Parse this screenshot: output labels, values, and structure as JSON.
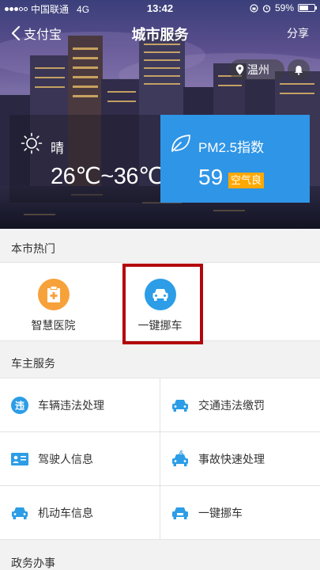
{
  "status_bar": {
    "carrier": "中国联通",
    "network": "4G",
    "time": "13:42",
    "battery_percent": "59%",
    "battery_level": 0.59
  },
  "navbar": {
    "back_label": "支付宝",
    "title": "城市服务",
    "share_label": "分享"
  },
  "location": {
    "city": "温州"
  },
  "weather": {
    "condition": "晴",
    "temperature": "26℃~36℃",
    "icon": "sun-icon"
  },
  "air_quality": {
    "label": "PM2.5指数",
    "value": "59",
    "level": "空气良",
    "card_color": "#2f95e6",
    "badge_color": "#ffa800"
  },
  "hot_section": {
    "title": "本市热门",
    "items": [
      {
        "label": "智慧医院",
        "icon": "hospital-icon",
        "color": "#f7a13a"
      },
      {
        "label": "一键挪车",
        "icon": "car-icon",
        "color": "#2c9de6"
      }
    ]
  },
  "car_section": {
    "title": "车主服务",
    "items": [
      {
        "label": "车辆违法处理",
        "icon": "violation-icon"
      },
      {
        "label": "交通违法缴罚",
        "icon": "car-fine-icon"
      },
      {
        "label": "驾驶人信息",
        "icon": "driver-id-icon"
      },
      {
        "label": "事故快速处理",
        "icon": "accident-icon"
      },
      {
        "label": "机动车信息",
        "icon": "vehicle-info-icon"
      },
      {
        "label": "一键挪车",
        "icon": "move-car-icon"
      }
    ],
    "icon_color": "#2c9de6"
  },
  "gov_section": {
    "title": "政务办事"
  }
}
